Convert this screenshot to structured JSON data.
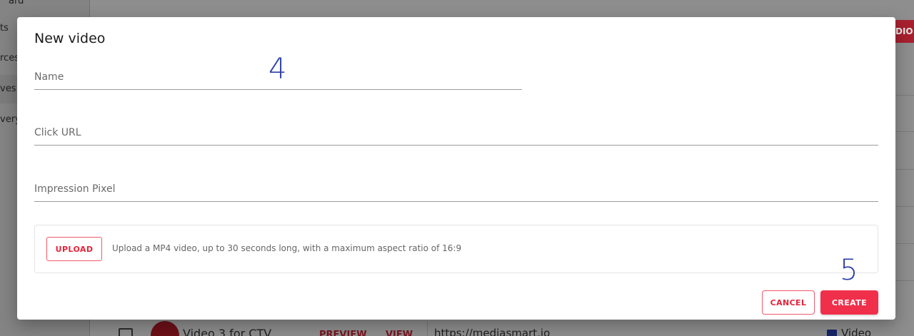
{
  "background": {
    "sidebar_items": [
      "ard",
      "ts",
      "rces",
      "ves",
      "very"
    ],
    "active_sidebar_index": 3,
    "header_button_label": "DIO",
    "table_row": {
      "name": "Video 3 for CTV",
      "preview_label": "PREVIEW",
      "view_label": "VIEW",
      "url": "https://mediasmart.io",
      "type": "Video"
    }
  },
  "dialog": {
    "title": "New video",
    "fields": {
      "name": {
        "placeholder": "Name",
        "value": ""
      },
      "click_url": {
        "placeholder": "Click URL",
        "value": ""
      },
      "impression_pixel": {
        "placeholder": "Impression Pixel",
        "value": ""
      }
    },
    "upload": {
      "button_label": "UPLOAD",
      "hint": "Upload a MP4 video, up to 30 seconds long, with a maximum aspect ratio of 16:9"
    },
    "actions": {
      "cancel_label": "CANCEL",
      "create_label": "CREATE"
    }
  },
  "annotations": [
    "4",
    "5"
  ],
  "colors": {
    "accent": "#f0304a",
    "annotation": "#2a3fa8"
  }
}
